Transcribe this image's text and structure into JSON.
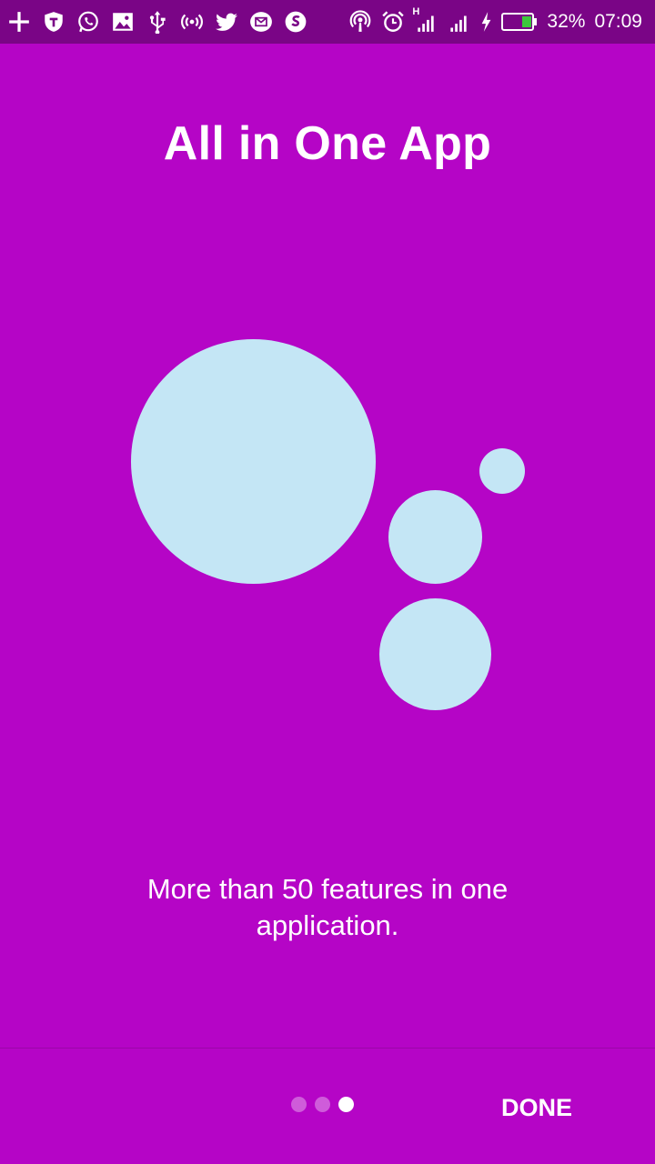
{
  "status_bar": {
    "left_icons": [
      "plus-icon",
      "shield-icon",
      "whatsapp-icon",
      "image-icon",
      "usb-icon",
      "hotspot-icon",
      "twitter-icon",
      "mail-icon",
      "s-app-icon"
    ],
    "right_icons": [
      "podcast-icon",
      "alarm-icon",
      "signal-h-icon",
      "signal-icon",
      "charging-icon",
      "battery-icon"
    ],
    "network_label": "H",
    "battery_percent": "32%",
    "battery_level": 0.32,
    "time": "07:09"
  },
  "onboarding": {
    "title": "All in One App",
    "description": "More than 50 features in one application.",
    "page_count": 3,
    "current_page": 3,
    "done_label": "DONE"
  },
  "colors": {
    "background": "#b505c6",
    "status_bar": "#7a0586",
    "bubble": "#c4e6f5",
    "battery_fill": "#3cc83c"
  }
}
